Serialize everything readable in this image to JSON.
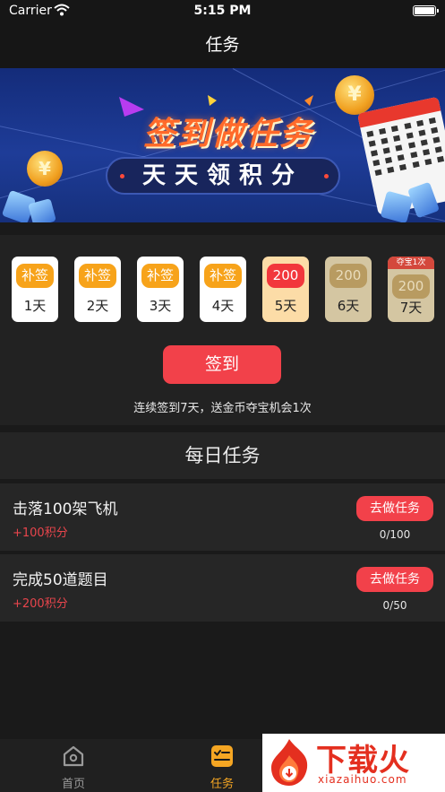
{
  "status_bar": {
    "carrier": "Carrier",
    "time": "5:15 PM"
  },
  "nav": {
    "title": "任务"
  },
  "banner": {
    "title": "签到做任务",
    "subtitle": "天天领积分",
    "coin_symbol": "¥"
  },
  "checkin": {
    "days": [
      {
        "badge": "补签",
        "label": "1天",
        "state": "missed"
      },
      {
        "badge": "补签",
        "label": "2天",
        "state": "missed"
      },
      {
        "badge": "补签",
        "label": "3天",
        "state": "missed"
      },
      {
        "badge": "补签",
        "label": "4天",
        "state": "missed"
      },
      {
        "badge": "200",
        "label": "5天",
        "state": "today"
      },
      {
        "badge": "200",
        "label": "6天",
        "state": "future"
      },
      {
        "badge": "200",
        "label": "7天",
        "state": "future",
        "tag": "夺宝1次"
      }
    ],
    "button_label": "签到",
    "tip": "连续签到7天，送金币夺宝机会1次"
  },
  "daily": {
    "title": "每日任务",
    "tasks": [
      {
        "name": "击落100架飞机",
        "reward": "+100积分",
        "button": "去做任务",
        "progress": "0/100"
      },
      {
        "name": "完成50道题目",
        "reward": "+200积分",
        "button": "去做任务",
        "progress": "0/50"
      }
    ]
  },
  "tabbar": {
    "home_label": "首页",
    "task_label": "任务",
    "colors": {
      "active": "#f5a623",
      "inactive": "#9a9a9a"
    }
  },
  "watermark": {
    "text": "下载火",
    "url": "xiazaihuo.com"
  }
}
